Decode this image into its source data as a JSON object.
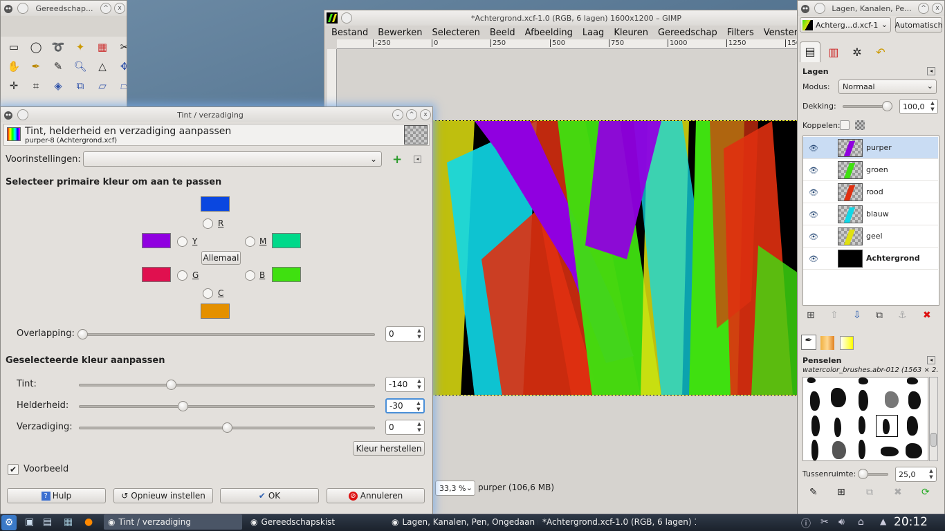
{
  "toolbox": {
    "title": "Gereedschap..."
  },
  "image_window": {
    "title": "*Achtergrond.xcf-1.0 (RGB, 6 lagen) 1600x1200 – GIMP",
    "menu": [
      "Bestand",
      "Bewerken",
      "Selecteren",
      "Beeld",
      "Afbeelding",
      "Laag",
      "Kleuren",
      "Gereedschap",
      "Filters",
      "Vensters"
    ],
    "ruler_ticks": [
      "-250",
      "0",
      "250",
      "500",
      "750",
      "1000",
      "1250",
      "1500"
    ],
    "zoom": "33,3 %",
    "status": "purper (106,6 MB)"
  },
  "dialog": {
    "window_title": "Tint / verzadiging",
    "heading": "Tint, helderheid en verzadiging aanpassen",
    "subheading": "purper-8 (Achtergrond.xcf)",
    "presets_label": "Voorinstellingen:",
    "presets_value": "",
    "primary_section": "Selecteer primaire kleur om aan te passen",
    "radios": {
      "r": "R",
      "y": "Y",
      "m": "M",
      "g": "G",
      "b": "B",
      "c": "C"
    },
    "all_button": "Allemaal",
    "overlap_label": "Overlapping:",
    "overlap_value": "0",
    "adjust_section": "Geselecteerde kleur aanpassen",
    "hue_label": "Tint:",
    "hue_value": "-140",
    "hue_level": 0.31,
    "lightness_label": "Helderheid:",
    "lightness_value": "-30",
    "lightness_level": 0.35,
    "saturation_label": "Verzadiging:",
    "saturation_value": "0",
    "saturation_level": 0.5,
    "reset_color": "Kleur herstellen",
    "preview_label": "Voorbeeld",
    "preview_checked": true,
    "buttons": {
      "help": "Hulp",
      "reset": "Opnieuw instellen",
      "ok": "OK",
      "cancel": "Annuleren"
    },
    "colors": {
      "r": "#0a47e0",
      "y": "#9000e0",
      "m": "#00d98a",
      "g": "#e0104f",
      "b": "#3fe010",
      "c": "#e49000"
    }
  },
  "layers_panel": {
    "title": "Lagen, Kanalen, Pe...",
    "image_select": "Achterg...d.xcf-1",
    "auto_button": "Automatisch",
    "tab_title": "Lagen",
    "mode_label": "Modus:",
    "mode_value": "Normaal",
    "opacity_label": "Dekking:",
    "opacity_value": "100,0",
    "lock_label": "Koppelen:",
    "layers": [
      {
        "name": "purper",
        "selected": true,
        "color": "#9000e0"
      },
      {
        "name": "groen",
        "selected": false,
        "color": "#3fe010"
      },
      {
        "name": "rood",
        "selected": false,
        "color": "#e03010"
      },
      {
        "name": "blauw",
        "selected": false,
        "color": "#10d8e8"
      },
      {
        "name": "geel",
        "selected": false,
        "color": "#e0e010"
      },
      {
        "name": "Achtergrond",
        "selected": false,
        "color": "#000000"
      }
    ],
    "brushes_title": "Penselen",
    "brush_name": "watercolor_brushes.abr-012 (1563 × 2...",
    "spacing_label": "Tussenruimte:",
    "spacing_value": "25,0"
  },
  "taskbar": {
    "items": [
      "Tint / verzadiging",
      "Gereedschapskist",
      "Lagen, Kanalen, Pen, Ongedaan ma",
      "*Achtergrond.xcf-1.0 (RGB, 6 lagen) 1"
    ],
    "clock": "20:12"
  }
}
